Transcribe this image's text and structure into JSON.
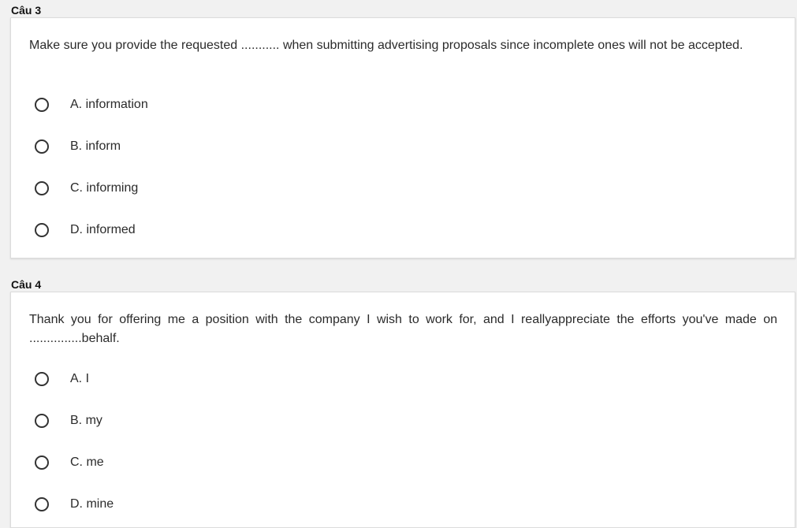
{
  "questions": [
    {
      "title": "Câu 3",
      "prompt": "Make sure you provide the requested ........... when submitting advertising proposals since incomplete ones will not be accepted.",
      "options": [
        "A. information",
        "B. inform",
        "C. informing",
        "D. informed"
      ]
    },
    {
      "title": "Câu 4",
      "prompt": "Thank you for offering me a position with the company I wish to work for, and I reallyappreciate the efforts you've made on ...............behalf.",
      "options": [
        "A. I",
        "B. my",
        "C. me",
        "D. mine"
      ]
    }
  ]
}
